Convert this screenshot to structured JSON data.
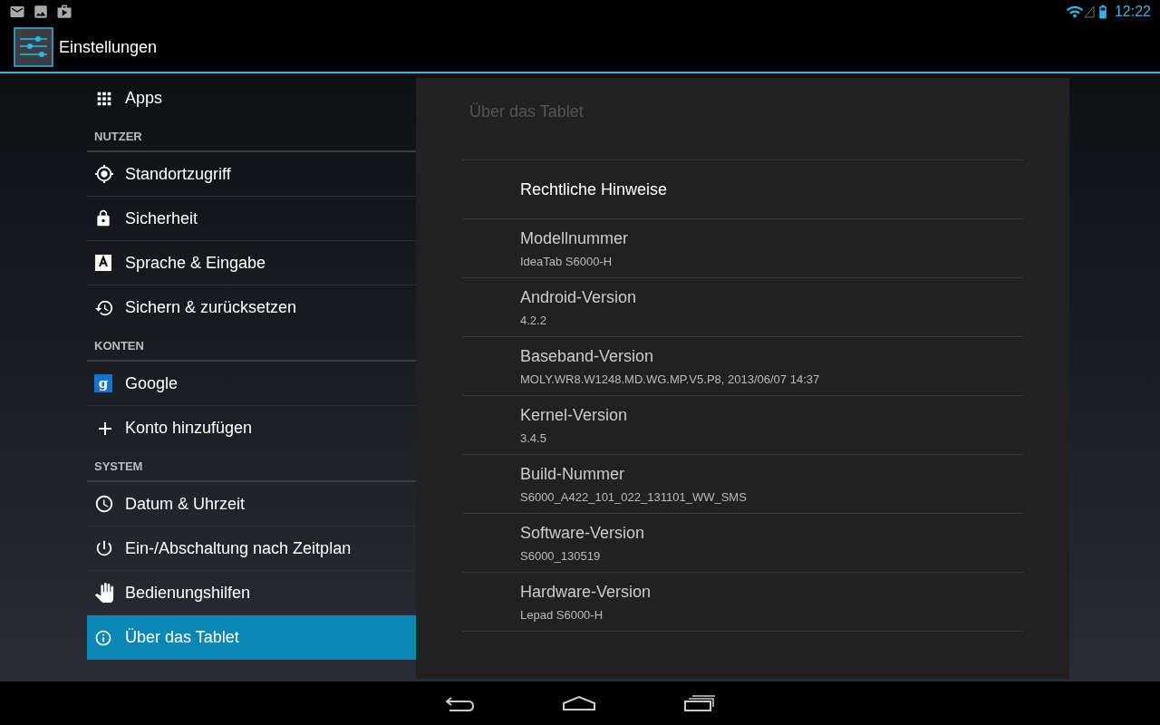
{
  "status_bar": {
    "time": "12:22"
  },
  "action_bar": {
    "title": "Einstellungen"
  },
  "sidebar": {
    "items": [
      {
        "kind": "item",
        "label": "Apps",
        "selected": false
      },
      {
        "kind": "header",
        "label": "NUTZER"
      },
      {
        "kind": "item",
        "label": "Standortzugriff",
        "selected": false
      },
      {
        "kind": "item",
        "label": "Sicherheit",
        "selected": false
      },
      {
        "kind": "item",
        "label": "Sprache & Eingabe",
        "selected": false
      },
      {
        "kind": "item",
        "label": "Sichern & zurücksetzen",
        "selected": false
      },
      {
        "kind": "header",
        "label": "KONTEN"
      },
      {
        "kind": "item",
        "label": "Google",
        "selected": false,
        "icon_letter": "g"
      },
      {
        "kind": "item",
        "label": "Konto hinzufügen",
        "selected": false
      },
      {
        "kind": "header",
        "label": "SYSTEM"
      },
      {
        "kind": "item",
        "label": "Datum & Uhrzeit",
        "selected": false
      },
      {
        "kind": "item",
        "label": "Ein-/Abschaltung nach Zeitplan",
        "selected": false
      },
      {
        "kind": "item",
        "label": "Bedienungshilfen",
        "selected": false
      },
      {
        "kind": "item",
        "label": "Über das Tablet",
        "selected": true
      }
    ]
  },
  "detail": {
    "title": "Über das Tablet",
    "rows": [
      {
        "title": "Rechtliche Hinweise"
      },
      {
        "title": "Modellnummer",
        "summary": "IdeaTab S6000-H"
      },
      {
        "title": "Android-Version",
        "summary": "4.2.2"
      },
      {
        "title": "Baseband-Version",
        "summary": "MOLY.WR8.W1248.MD.WG.MP.V5.P8, 2013/06/07 14:37"
      },
      {
        "title": "Kernel-Version",
        "summary": "3.4.5"
      },
      {
        "title": "Build-Nummer",
        "summary": "S6000_A422_101_022_131101_WW_SMS"
      },
      {
        "title": "Software-Version",
        "summary": "S6000_130519"
      },
      {
        "title": "Hardware-Version",
        "summary": "Lepad S6000-H"
      }
    ]
  }
}
